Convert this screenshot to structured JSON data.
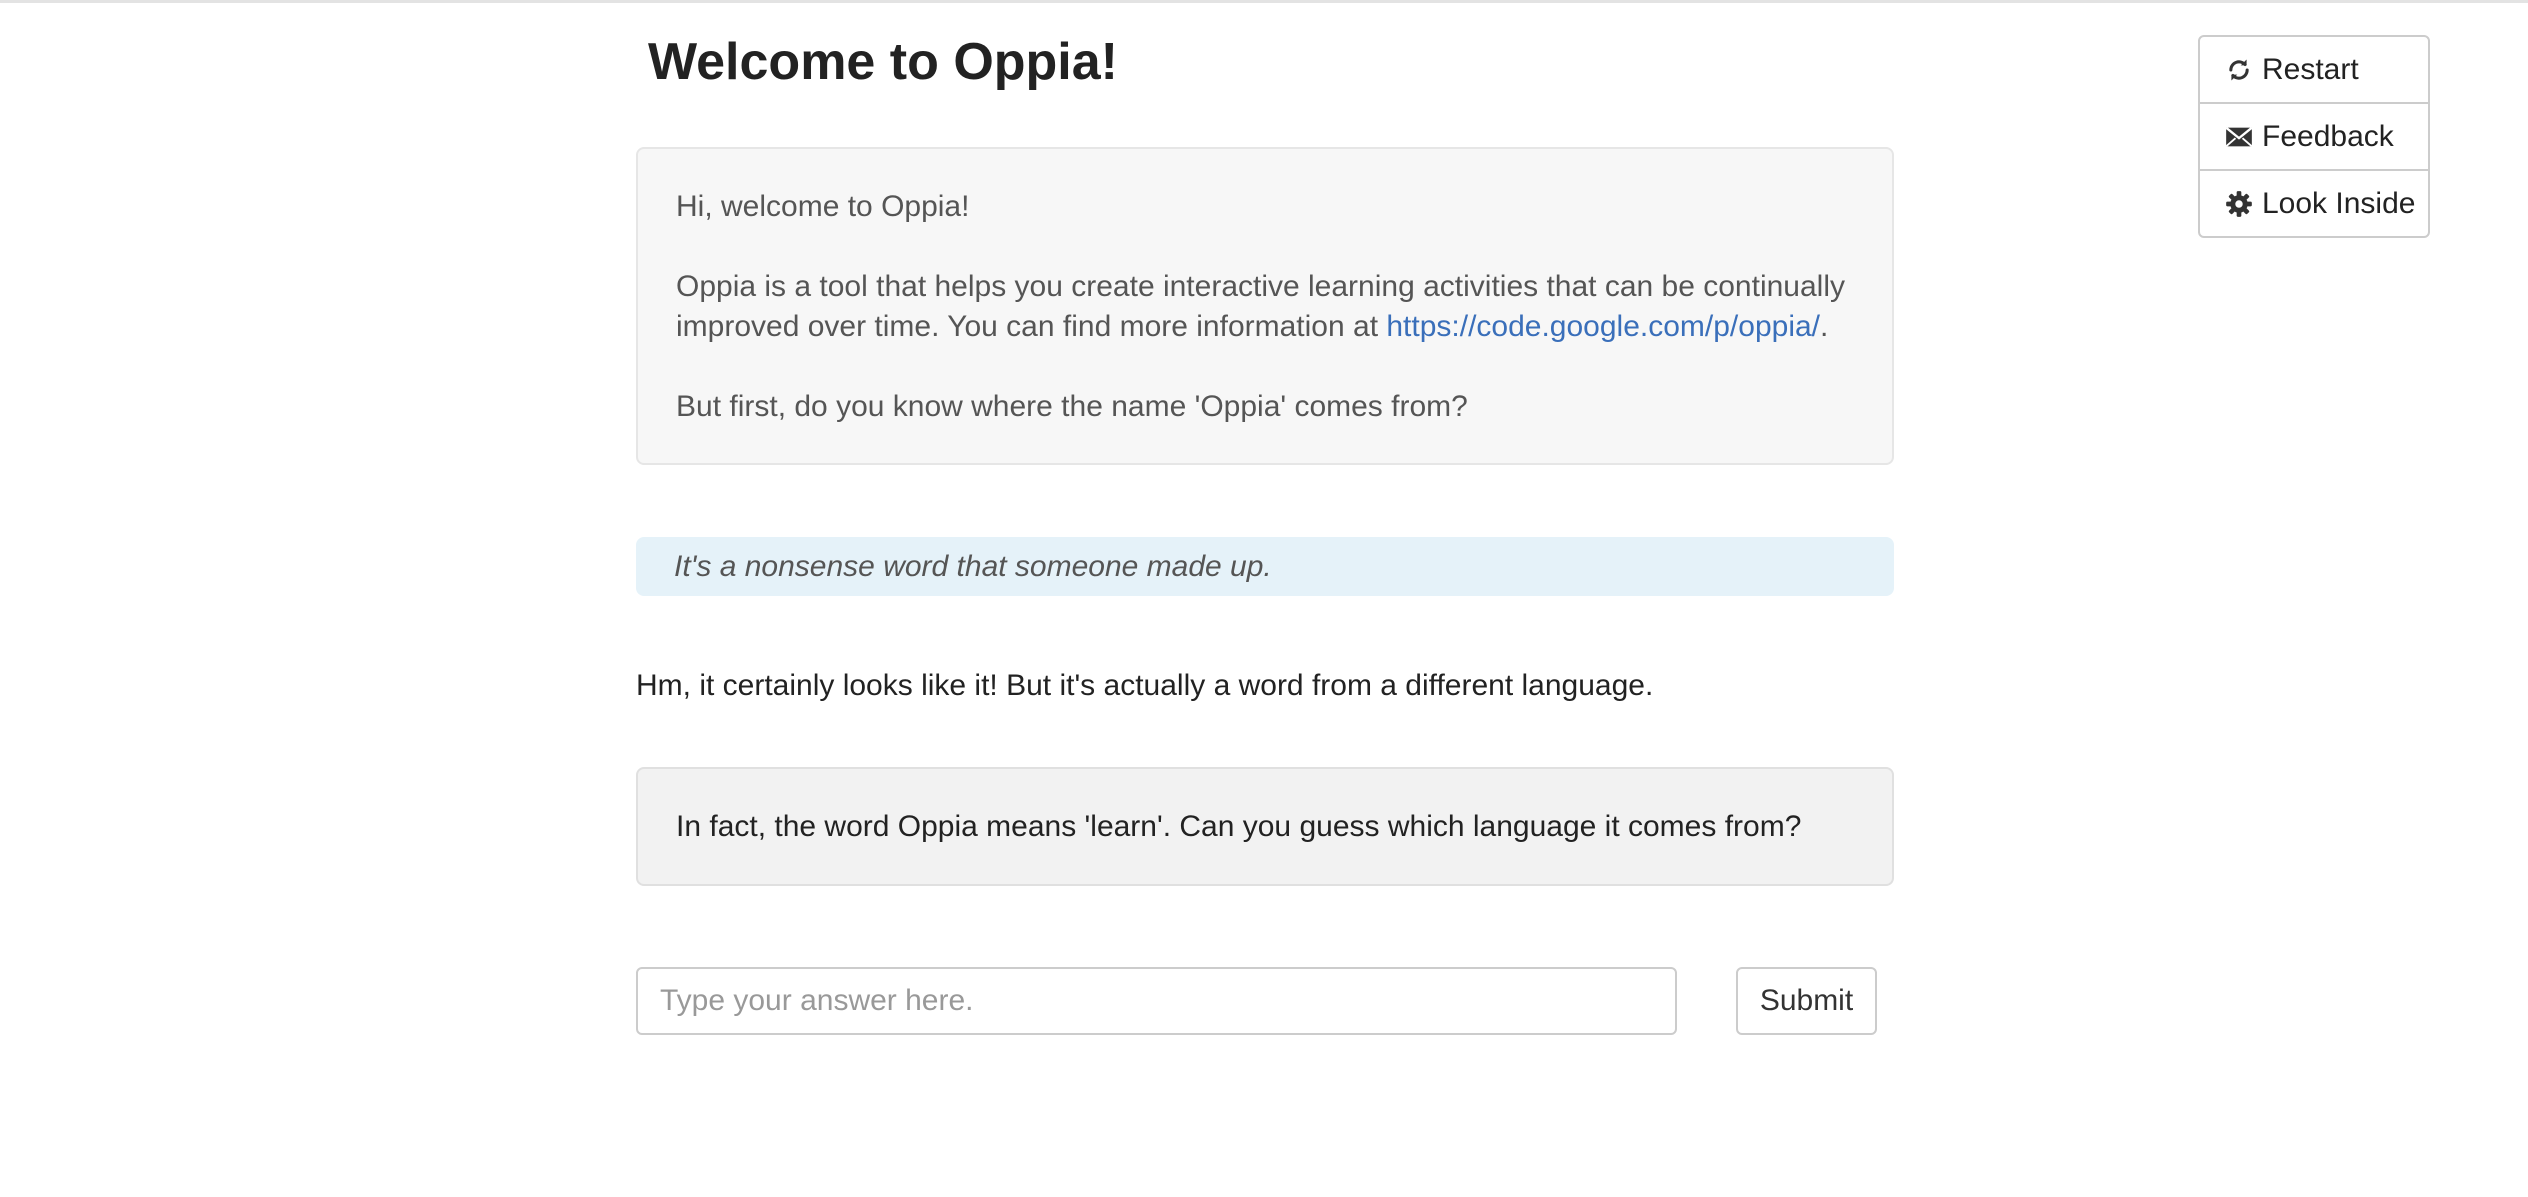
{
  "page": {
    "title": "Welcome to Oppia!"
  },
  "intro": {
    "greeting": "Hi, welcome to Oppia!",
    "description_before_link": "Oppia is a tool that helps you create interactive learning activities that can be continually improved over time. You can find more information at ",
    "link_text": "https://code.google.com/p/oppia/",
    "description_after_link": ".",
    "question": "But first, do you know where the name 'Oppia' comes from?"
  },
  "learner_answer": "It's a nonsense word that someone made up.",
  "feedback": "Hm, it certainly looks like it! But it's actually a word from a different language.",
  "follow_up_question": "In fact, the word Oppia means 'learn'. Can you guess which language it comes from?",
  "answer_form": {
    "placeholder": "Type your answer here.",
    "value": "",
    "submit_label": "Submit"
  },
  "side_menu": {
    "items": [
      {
        "label": "Restart",
        "icon": "refresh-icon"
      },
      {
        "label": "Feedback",
        "icon": "envelope-icon"
      },
      {
        "label": "Look Inside",
        "icon": "gear-icon"
      }
    ]
  },
  "colors": {
    "link": "#3a6fba",
    "answer_bubble": "#e5f2f9",
    "intro_box": "#f7f7f7",
    "question_box": "#f2f2f2"
  }
}
